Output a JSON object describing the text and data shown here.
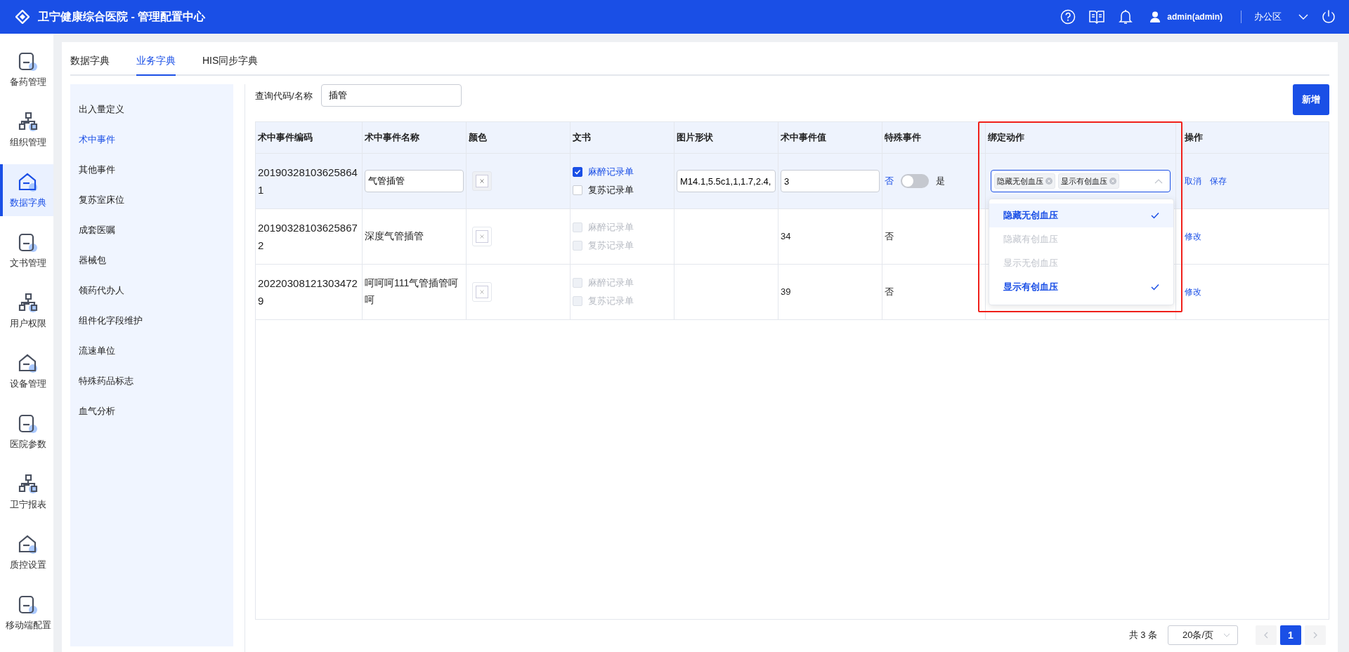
{
  "header": {
    "title": "卫宁健康综合医院 - 管理配置中心",
    "user": "admin(admin)",
    "region": "办公区"
  },
  "nav": [
    {
      "label": "备药管理",
      "selected": false
    },
    {
      "label": "组织管理",
      "selected": false
    },
    {
      "label": "数据字典",
      "selected": true
    },
    {
      "label": "文书管理",
      "selected": false
    },
    {
      "label": "用户权限",
      "selected": false
    },
    {
      "label": "设备管理",
      "selected": false
    },
    {
      "label": "医院参数",
      "selected": false
    },
    {
      "label": "卫宁报表",
      "selected": false
    },
    {
      "label": "质控设置",
      "selected": false
    },
    {
      "label": "移动端配置",
      "selected": false
    }
  ],
  "tabs": [
    {
      "label": "数据字典",
      "selected": false
    },
    {
      "label": "业务字典",
      "selected": true
    },
    {
      "label": "HIS同步字典",
      "selected": false
    }
  ],
  "submenu": [
    {
      "label": "出入量定义",
      "selected": false
    },
    {
      "label": "术中事件",
      "selected": true
    },
    {
      "label": "其他事件",
      "selected": false
    },
    {
      "label": "复苏室床位",
      "selected": false
    },
    {
      "label": "成套医嘱",
      "selected": false
    },
    {
      "label": "器械包",
      "selected": false
    },
    {
      "label": "领药代办人",
      "selected": false
    },
    {
      "label": "组件化字段维护",
      "selected": false
    },
    {
      "label": "流速单位",
      "selected": false
    },
    {
      "label": "特殊药品标志",
      "selected": false
    },
    {
      "label": "血气分析",
      "selected": false
    }
  ],
  "search": {
    "label": "查询代码/名称",
    "value": "插管"
  },
  "add_button": "新增",
  "table": {
    "columns": [
      "术中事件编码",
      "术中事件名称",
      "颜色",
      "文书",
      "图片形状",
      "术中事件值",
      "特殊事件",
      "绑定动作",
      "操作"
    ],
    "rows": [
      {
        "editing": true,
        "code": "201903281036258641",
        "name": "气管插管",
        "docs": [
          {
            "label": "麻醉记录单",
            "checked": true,
            "disabled": false
          },
          {
            "label": "复苏记录单",
            "checked": false,
            "disabled": false
          }
        ],
        "shape": "M14.1,5.5c1,1,1.7,2.4,",
        "value": "3",
        "special": {
          "off_label": "否",
          "on_label": "是",
          "on": false
        },
        "tags": [
          "隐藏无创血压",
          "显示有创血压"
        ],
        "actions": [
          "取消",
          "保存"
        ]
      },
      {
        "editing": false,
        "code": "201903281036258672",
        "name": "深度气管插管",
        "docs": [
          {
            "label": "麻醉记录单",
            "checked": false,
            "disabled": true
          },
          {
            "label": "复苏记录单",
            "checked": false,
            "disabled": true
          }
        ],
        "shape": "",
        "value": "34",
        "special_text": "否",
        "actions": [
          "修改"
        ]
      },
      {
        "editing": false,
        "code": "202203081213034729",
        "name": "呵呵呵111气管插管呵呵",
        "docs": [
          {
            "label": "麻醉记录单",
            "checked": false,
            "disabled": true
          },
          {
            "label": "复苏记录单",
            "checked": false,
            "disabled": true
          }
        ],
        "shape": "",
        "value": "39",
        "special_text": "否",
        "actions": [
          "修改"
        ]
      }
    ]
  },
  "dropdown": {
    "options": [
      {
        "label": "隐藏无创血压",
        "selected": true,
        "disabled": false
      },
      {
        "label": "隐藏有创血压",
        "selected": false,
        "disabled": true
      },
      {
        "label": "显示无创血压",
        "selected": false,
        "disabled": true
      },
      {
        "label": "显示有创血压",
        "selected": true,
        "disabled": false
      }
    ]
  },
  "pagination": {
    "total": "共 3 条",
    "page_size": "20条/页",
    "pages": [
      {
        "label": "1",
        "selected": true
      }
    ]
  }
}
